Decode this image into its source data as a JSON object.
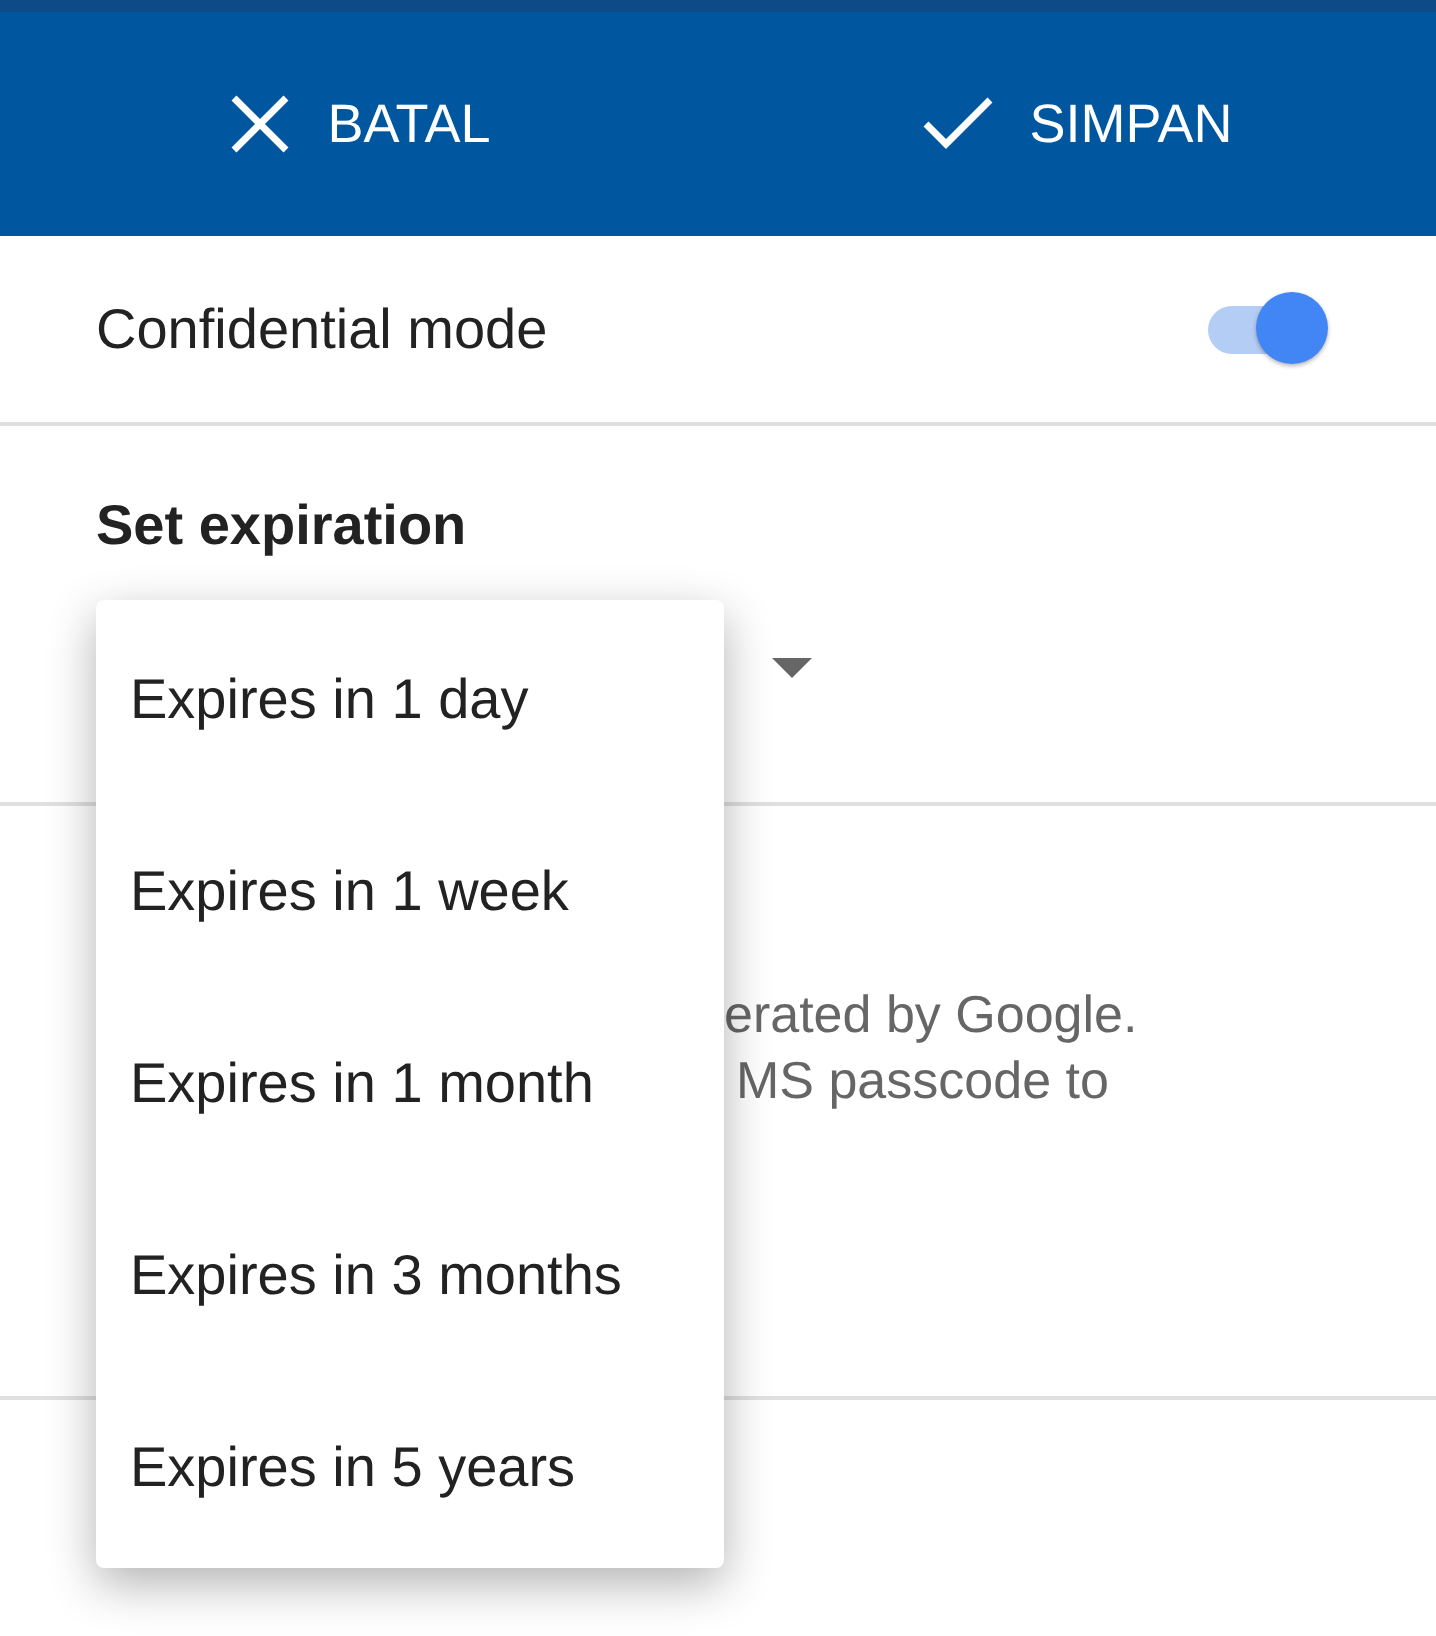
{
  "toolbar": {
    "cancel": "BATAL",
    "save": "SIMPAN"
  },
  "confidential_mode": {
    "label": "Confidential mode",
    "on": true
  },
  "expiration": {
    "heading": "Set expiration"
  },
  "hidden_text": [
    "erated by Google.",
    "MS passcode to"
  ],
  "menu": [
    {
      "label": "Expires in 1 day",
      "selected": false
    },
    {
      "label": "Expires in 1 week",
      "selected": false
    },
    {
      "label": "Expires in 1 month",
      "selected": false
    },
    {
      "label": "Expires in 3 months",
      "selected": false
    },
    {
      "label": "Expires in 5 years",
      "selected": false
    }
  ]
}
